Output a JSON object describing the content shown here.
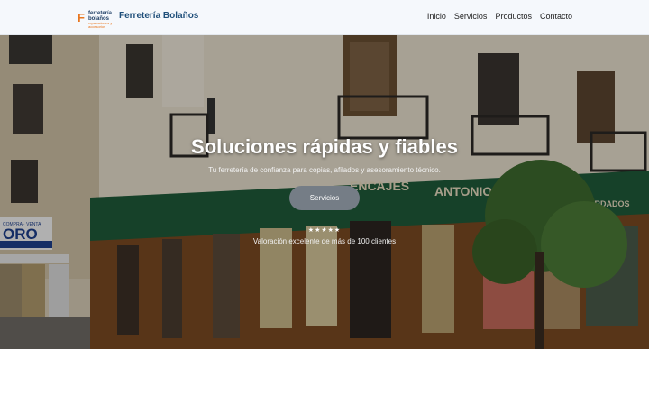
{
  "header": {
    "logo": {
      "mark": "F",
      "line1": "ferretería",
      "line2": "bolaños",
      "line3": "reparaciones y accesorios"
    },
    "brand": "Ferretería Bolaños",
    "nav": [
      {
        "label": "Inicio",
        "active": true
      },
      {
        "label": "Servicios",
        "active": false
      },
      {
        "label": "Productos",
        "active": false
      },
      {
        "label": "Contacto",
        "active": false
      }
    ]
  },
  "hero": {
    "title": "Soluciones rápidas y fiables",
    "subtitle": "Tu ferretería de confianza para copias, afilados y asesoramiento técnico.",
    "button": "Servicios",
    "stars": "★★★★★",
    "rating": "Valoración excelente de más de 100 clientes"
  },
  "photo": {
    "signs": [
      "ORO",
      "COMPRA · VENTA",
      "ENCAJES",
      "ANTONIO",
      "BORDADOS"
    ]
  }
}
